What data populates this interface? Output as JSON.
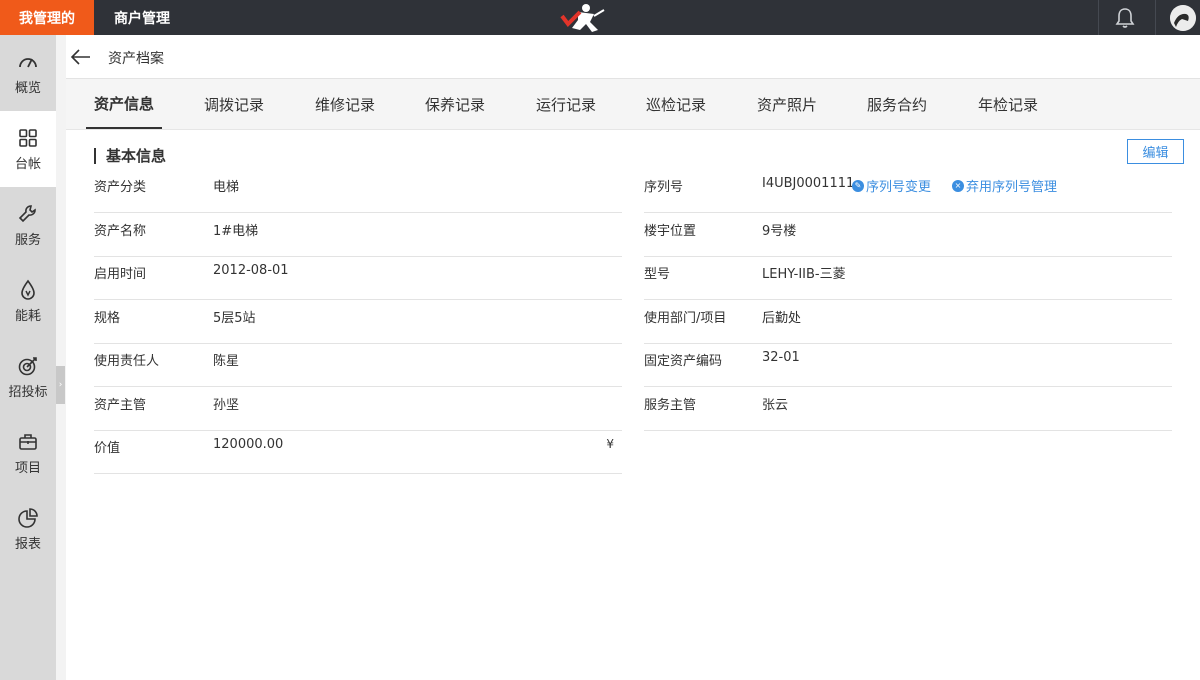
{
  "topbar": {
    "brand_tab": "我管理的",
    "module_tab": "商户管理",
    "logo_icon": "running-man-logo",
    "bell_icon": "bell-icon",
    "accent": "#f05a1a"
  },
  "sidebar": {
    "items": [
      {
        "label": "概览",
        "icon": "speedometer-icon"
      },
      {
        "label": "台帐",
        "icon": "grid-icon"
      },
      {
        "label": "服务",
        "icon": "wrench-icon"
      },
      {
        "label": "能耗",
        "icon": "drop-icon"
      },
      {
        "label": "招投标",
        "icon": "target-icon"
      },
      {
        "label": "项目",
        "icon": "briefcase-icon"
      },
      {
        "label": "报表",
        "icon": "pie-chart-icon"
      }
    ],
    "toggle": "›"
  },
  "header": {
    "title": "资产档案"
  },
  "tabs": [
    {
      "label": "资产信息"
    },
    {
      "label": "调拨记录"
    },
    {
      "label": "维修记录"
    },
    {
      "label": "保养记录"
    },
    {
      "label": "运行记录"
    },
    {
      "label": "巡检记录"
    },
    {
      "label": "资产照片"
    },
    {
      "label": "服务合约"
    },
    {
      "label": "年检记录"
    }
  ],
  "section": {
    "title": "基本信息",
    "edit_label": "编辑"
  },
  "left_fields": [
    {
      "label": "资产分类",
      "value": "电梯"
    },
    {
      "label": "资产名称",
      "value": "1#电梯"
    },
    {
      "label": "启用时间",
      "value": "2012-08-01"
    },
    {
      "label": "规格",
      "value": "5层5站"
    },
    {
      "label": "使用责任人",
      "value": "陈星"
    },
    {
      "label": "资产主管",
      "value": "孙坚"
    },
    {
      "label": "价值",
      "value": "120000.00",
      "unit": "¥"
    }
  ],
  "right_fields": [
    {
      "label": "序列号",
      "value": "I4UBJ0001111"
    },
    {
      "label": "楼宇位置",
      "value": "9号楼"
    },
    {
      "label": "型号",
      "value": "LEHY-IIB-三菱"
    },
    {
      "label": "使用部门/项目",
      "value": "后勤处"
    },
    {
      "label": "固定资产编码",
      "value": "32-01"
    },
    {
      "label": "服务主管",
      "value": "张云"
    }
  ],
  "serial_links": {
    "change": "序列号变更",
    "manage": "弃用序列号管理"
  }
}
